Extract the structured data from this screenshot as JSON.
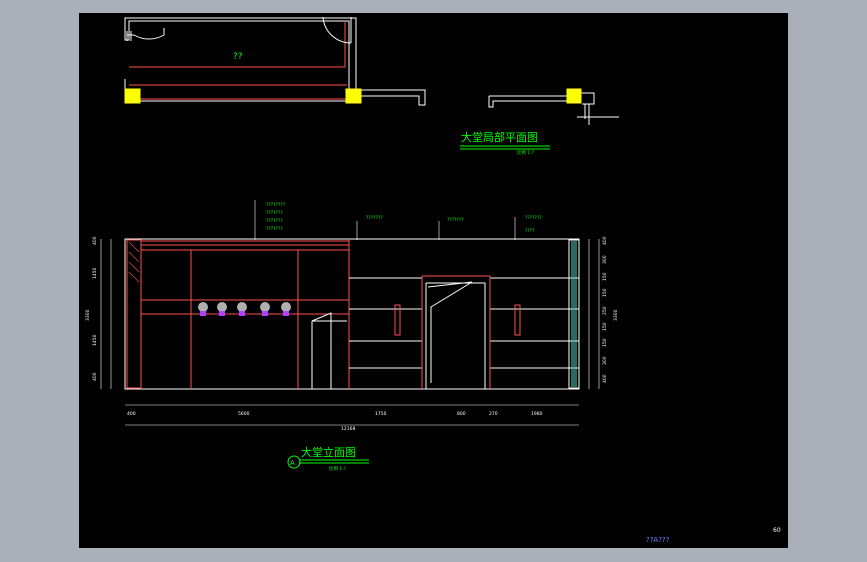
{
  "plan": {
    "room_label": "??",
    "title": "大堂局部平面图",
    "scale": "比例 1:?"
  },
  "elevation": {
    "title": "大堂立面图",
    "scale": "比例 1:?",
    "mark": "A",
    "callouts": [
      "????????",
      "???????",
      "???????",
      "???????",
      "???????",
      "???????",
      "???????",
      "????"
    ],
    "left_dims": [
      "400",
      "1450",
      "1450",
      "400"
    ],
    "left_total": "3300",
    "right_dims": [
      "400",
      "300",
      "150",
      "150",
      "250",
      "150",
      "150",
      "300",
      "400"
    ],
    "right_total": "3300",
    "bottom_dims": [
      "400",
      "5600",
      "1750",
      "800",
      "270",
      "1980"
    ],
    "bottom_total": "12168"
  },
  "footer": {
    "sheet_code": "??A???",
    "page_number": "60"
  },
  "colors": {
    "sheet": "#000000",
    "frame": "#a9b0b9",
    "text_green": "#00ff00",
    "red_line": "#ff5050",
    "white_line": "#ffffff",
    "column_fill": "#ffff00",
    "glass": "#4fd4c0"
  }
}
